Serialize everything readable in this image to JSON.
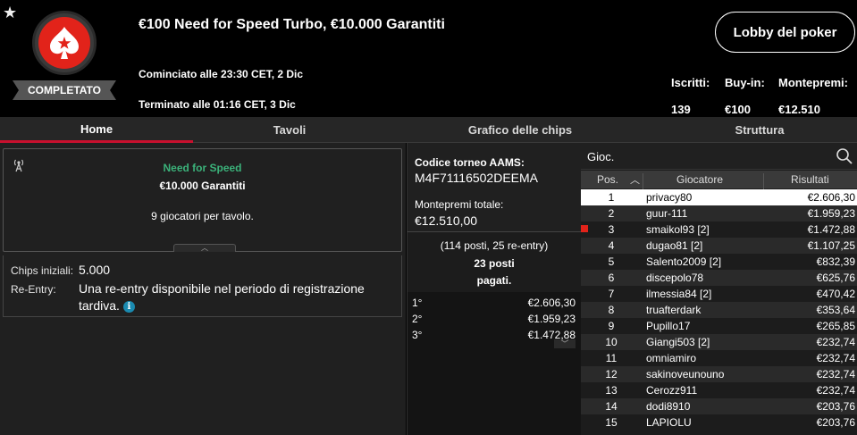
{
  "tournament": {
    "title": "€100 Need for Speed Turbo, €10.000 Garantiti",
    "status": "COMPLETATO",
    "started": "Cominciato alle 23:30 CET, 2 Dic",
    "ended": "Terminato alle 01:16 CET, 3 Dic"
  },
  "header": {
    "lobby_button": "Lobby del poker",
    "stats": [
      {
        "label": "Iscritti:",
        "value": "139"
      },
      {
        "label": "Buy-in:",
        "value": "€100"
      },
      {
        "label": "Montepremi:",
        "value": "€12.510"
      }
    ]
  },
  "tabs": [
    {
      "label": "Home",
      "active": true
    },
    {
      "label": "Tavoli",
      "active": false
    },
    {
      "label": "Grafico delle chips",
      "active": false
    },
    {
      "label": "Struttura",
      "active": false
    }
  ],
  "info": {
    "name": "Need for Speed",
    "guarantee": "€10.000 Garantiti",
    "players_per_table": "9 giocatori per tavolo.",
    "name_color": "#3bb27a"
  },
  "details": {
    "chips_label": "Chips iniziali:",
    "chips_value": "5.000",
    "reentry_label": "Re-Entry:",
    "reentry_value": "Una re-entry disponibile nel periodo di registrazione tardiva.",
    "info_icon": "i"
  },
  "middle": {
    "aams_label": "Codice torneo AAMS:",
    "aams_code": "M4F71116502DEEMA",
    "prize_label": "Montepremi totale:",
    "prize_value": "€12.510,00",
    "entries": "(114 posti, 25 re-entry)",
    "paid_line1": "23 posti",
    "paid_line2": "pagati.",
    "prizes": [
      {
        "pos": "1°",
        "amount": "€2.606,30"
      },
      {
        "pos": "2°",
        "amount": "€1.959,23"
      },
      {
        "pos": "3°",
        "amount": "€1.472,88"
      }
    ]
  },
  "players": {
    "search_label": "Gioc.",
    "col_pos": "Pos.",
    "col_player": "Giocatore",
    "col_result": "Risultati",
    "rows": [
      {
        "pos": "1",
        "name": "privacy80",
        "result": "€2.606,30"
      },
      {
        "pos": "2",
        "name": "guur-111",
        "result": "€1.959,23"
      },
      {
        "pos": "3",
        "name": "smaikol93 [2]",
        "result": "€1.472,88"
      },
      {
        "pos": "4",
        "name": "dugao81 [2]",
        "result": "€1.107,25"
      },
      {
        "pos": "5",
        "name": "Salento2009 [2]",
        "result": "€832,39"
      },
      {
        "pos": "6",
        "name": "discepolo78",
        "result": "€625,76"
      },
      {
        "pos": "7",
        "name": "ilmessia84 [2]",
        "result": "€470,42"
      },
      {
        "pos": "8",
        "name": "truafterdark",
        "result": "€353,64"
      },
      {
        "pos": "9",
        "name": "Pupillo17",
        "result": "€265,85"
      },
      {
        "pos": "10",
        "name": "Giangi503 [2]",
        "result": "€232,74"
      },
      {
        "pos": "11",
        "name": "omniamiro",
        "result": "€232,74"
      },
      {
        "pos": "12",
        "name": "sakinoveunouno",
        "result": "€232,74"
      },
      {
        "pos": "13",
        "name": "Cerozz911",
        "result": "€232,74"
      },
      {
        "pos": "14",
        "name": "dodi8910",
        "result": "€203,76"
      },
      {
        "pos": "15",
        "name": "LAPIOLU",
        "result": "€203,76"
      }
    ]
  },
  "colors": {
    "accent": "#c8102e",
    "logo": "#e2231a",
    "info": "#1a8ab0"
  }
}
